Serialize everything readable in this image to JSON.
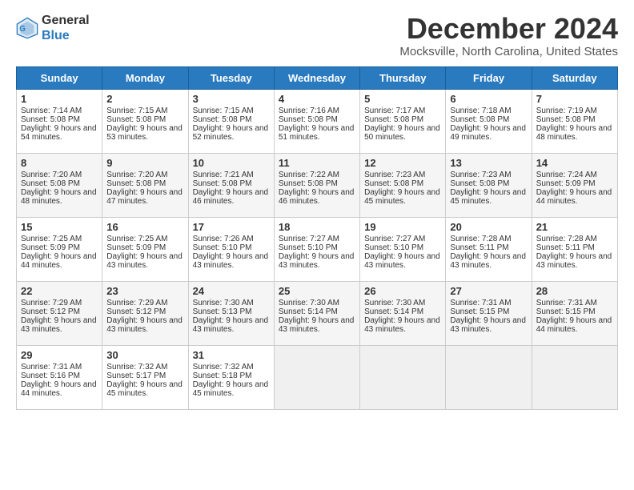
{
  "logo": {
    "line1": "General",
    "line2": "Blue"
  },
  "title": "December 2024",
  "location": "Mocksville, North Carolina, United States",
  "days_of_week": [
    "Sunday",
    "Monday",
    "Tuesday",
    "Wednesday",
    "Thursday",
    "Friday",
    "Saturday"
  ],
  "weeks": [
    [
      {
        "day": "1",
        "sunrise": "Sunrise: 7:14 AM",
        "sunset": "Sunset: 5:08 PM",
        "daylight": "Daylight: 9 hours and 54 minutes."
      },
      {
        "day": "2",
        "sunrise": "Sunrise: 7:15 AM",
        "sunset": "Sunset: 5:08 PM",
        "daylight": "Daylight: 9 hours and 53 minutes."
      },
      {
        "day": "3",
        "sunrise": "Sunrise: 7:15 AM",
        "sunset": "Sunset: 5:08 PM",
        "daylight": "Daylight: 9 hours and 52 minutes."
      },
      {
        "day": "4",
        "sunrise": "Sunrise: 7:16 AM",
        "sunset": "Sunset: 5:08 PM",
        "daylight": "Daylight: 9 hours and 51 minutes."
      },
      {
        "day": "5",
        "sunrise": "Sunrise: 7:17 AM",
        "sunset": "Sunset: 5:08 PM",
        "daylight": "Daylight: 9 hours and 50 minutes."
      },
      {
        "day": "6",
        "sunrise": "Sunrise: 7:18 AM",
        "sunset": "Sunset: 5:08 PM",
        "daylight": "Daylight: 9 hours and 49 minutes."
      },
      {
        "day": "7",
        "sunrise": "Sunrise: 7:19 AM",
        "sunset": "Sunset: 5:08 PM",
        "daylight": "Daylight: 9 hours and 48 minutes."
      }
    ],
    [
      {
        "day": "8",
        "sunrise": "Sunrise: 7:20 AM",
        "sunset": "Sunset: 5:08 PM",
        "daylight": "Daylight: 9 hours and 48 minutes."
      },
      {
        "day": "9",
        "sunrise": "Sunrise: 7:20 AM",
        "sunset": "Sunset: 5:08 PM",
        "daylight": "Daylight: 9 hours and 47 minutes."
      },
      {
        "day": "10",
        "sunrise": "Sunrise: 7:21 AM",
        "sunset": "Sunset: 5:08 PM",
        "daylight": "Daylight: 9 hours and 46 minutes."
      },
      {
        "day": "11",
        "sunrise": "Sunrise: 7:22 AM",
        "sunset": "Sunset: 5:08 PM",
        "daylight": "Daylight: 9 hours and 46 minutes."
      },
      {
        "day": "12",
        "sunrise": "Sunrise: 7:23 AM",
        "sunset": "Sunset: 5:08 PM",
        "daylight": "Daylight: 9 hours and 45 minutes."
      },
      {
        "day": "13",
        "sunrise": "Sunrise: 7:23 AM",
        "sunset": "Sunset: 5:08 PM",
        "daylight": "Daylight: 9 hours and 45 minutes."
      },
      {
        "day": "14",
        "sunrise": "Sunrise: 7:24 AM",
        "sunset": "Sunset: 5:09 PM",
        "daylight": "Daylight: 9 hours and 44 minutes."
      }
    ],
    [
      {
        "day": "15",
        "sunrise": "Sunrise: 7:25 AM",
        "sunset": "Sunset: 5:09 PM",
        "daylight": "Daylight: 9 hours and 44 minutes."
      },
      {
        "day": "16",
        "sunrise": "Sunrise: 7:25 AM",
        "sunset": "Sunset: 5:09 PM",
        "daylight": "Daylight: 9 hours and 43 minutes."
      },
      {
        "day": "17",
        "sunrise": "Sunrise: 7:26 AM",
        "sunset": "Sunset: 5:10 PM",
        "daylight": "Daylight: 9 hours and 43 minutes."
      },
      {
        "day": "18",
        "sunrise": "Sunrise: 7:27 AM",
        "sunset": "Sunset: 5:10 PM",
        "daylight": "Daylight: 9 hours and 43 minutes."
      },
      {
        "day": "19",
        "sunrise": "Sunrise: 7:27 AM",
        "sunset": "Sunset: 5:10 PM",
        "daylight": "Daylight: 9 hours and 43 minutes."
      },
      {
        "day": "20",
        "sunrise": "Sunrise: 7:28 AM",
        "sunset": "Sunset: 5:11 PM",
        "daylight": "Daylight: 9 hours and 43 minutes."
      },
      {
        "day": "21",
        "sunrise": "Sunrise: 7:28 AM",
        "sunset": "Sunset: 5:11 PM",
        "daylight": "Daylight: 9 hours and 43 minutes."
      }
    ],
    [
      {
        "day": "22",
        "sunrise": "Sunrise: 7:29 AM",
        "sunset": "Sunset: 5:12 PM",
        "daylight": "Daylight: 9 hours and 43 minutes."
      },
      {
        "day": "23",
        "sunrise": "Sunrise: 7:29 AM",
        "sunset": "Sunset: 5:12 PM",
        "daylight": "Daylight: 9 hours and 43 minutes."
      },
      {
        "day": "24",
        "sunrise": "Sunrise: 7:30 AM",
        "sunset": "Sunset: 5:13 PM",
        "daylight": "Daylight: 9 hours and 43 minutes."
      },
      {
        "day": "25",
        "sunrise": "Sunrise: 7:30 AM",
        "sunset": "Sunset: 5:14 PM",
        "daylight": "Daylight: 9 hours and 43 minutes."
      },
      {
        "day": "26",
        "sunrise": "Sunrise: 7:30 AM",
        "sunset": "Sunset: 5:14 PM",
        "daylight": "Daylight: 9 hours and 43 minutes."
      },
      {
        "day": "27",
        "sunrise": "Sunrise: 7:31 AM",
        "sunset": "Sunset: 5:15 PM",
        "daylight": "Daylight: 9 hours and 43 minutes."
      },
      {
        "day": "28",
        "sunrise": "Sunrise: 7:31 AM",
        "sunset": "Sunset: 5:15 PM",
        "daylight": "Daylight: 9 hours and 44 minutes."
      }
    ],
    [
      {
        "day": "29",
        "sunrise": "Sunrise: 7:31 AM",
        "sunset": "Sunset: 5:16 PM",
        "daylight": "Daylight: 9 hours and 44 minutes."
      },
      {
        "day": "30",
        "sunrise": "Sunrise: 7:32 AM",
        "sunset": "Sunset: 5:17 PM",
        "daylight": "Daylight: 9 hours and 45 minutes."
      },
      {
        "day": "31",
        "sunrise": "Sunrise: 7:32 AM",
        "sunset": "Sunset: 5:18 PM",
        "daylight": "Daylight: 9 hours and 45 minutes."
      },
      null,
      null,
      null,
      null
    ]
  ]
}
